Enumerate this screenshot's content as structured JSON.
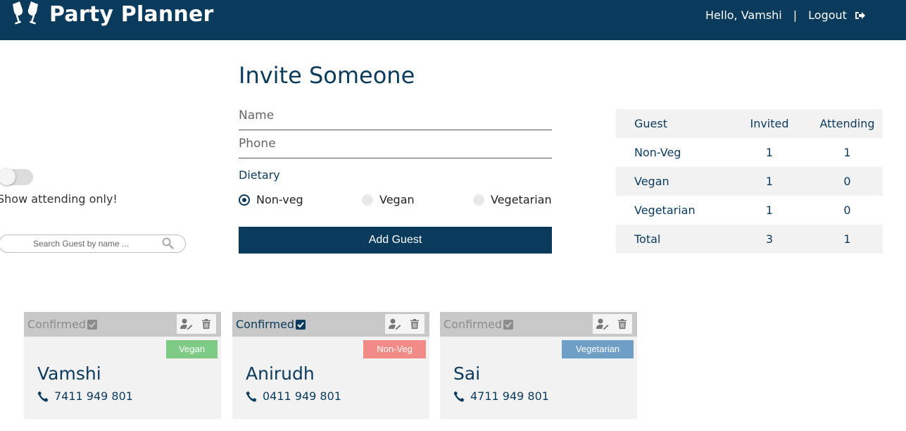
{
  "app": {
    "title": "Party Planner"
  },
  "user": {
    "greeting": "Hello, Vamshi",
    "separator": "|",
    "logout_label": "Logout"
  },
  "filters": {
    "toggle_label": "Show attending only!",
    "attending_only": false,
    "search_placeholder": "Search Guest by name ..."
  },
  "invite": {
    "title": "Invite Someone",
    "name_placeholder": "Name",
    "phone_placeholder": "Phone",
    "dietary_label": "Dietary",
    "options": [
      {
        "label": "Non-veg",
        "checked": true
      },
      {
        "label": "Vegan",
        "checked": false
      },
      {
        "label": "Vegetarian",
        "checked": false
      }
    ],
    "add_button": "Add Guest"
  },
  "stats": {
    "headers": [
      "Guest",
      "Invited",
      "Attending"
    ],
    "rows": [
      [
        "Non-Veg",
        "1",
        "1"
      ],
      [
        "Vegan",
        "1",
        "0"
      ],
      [
        "Vegetarian",
        "1",
        "0"
      ],
      [
        "Total",
        "3",
        "1"
      ]
    ]
  },
  "guests": [
    {
      "confirmed_label": "Confirmed",
      "confirmed": false,
      "diet": "Vegan",
      "diet_color": "#7dcb85",
      "name": "Vamshi",
      "phone": "7411 949 801"
    },
    {
      "confirmed_label": "Confirmed",
      "confirmed": true,
      "diet": "Non-Veg",
      "diet_color": "#f28b88",
      "name": "Anirudh",
      "phone": "0411 949 801"
    },
    {
      "confirmed_label": "Confirmed",
      "confirmed": false,
      "diet": "Vegetarian",
      "diet_color": "#6f9fc4",
      "name": "Sai",
      "phone": "4711 949 801"
    }
  ],
  "colors": {
    "primary": "#0a3a5c",
    "panel": "#f2f2f2",
    "card_header": "#c8c8c8"
  }
}
